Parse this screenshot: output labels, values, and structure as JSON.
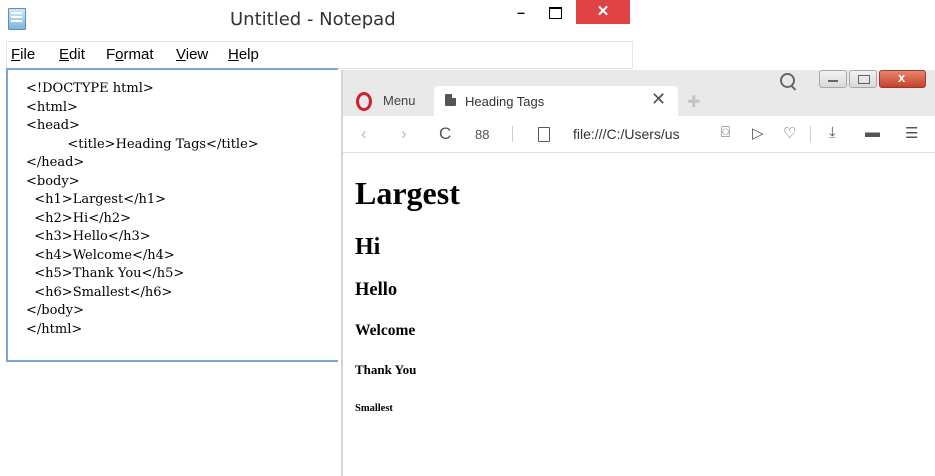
{
  "notepad": {
    "title": "Untitled - Notepad",
    "menu": [
      "File",
      "Edit",
      "Format",
      "View",
      "Help"
    ],
    "menu_mnemonics": [
      "F",
      "E",
      "o",
      "V",
      "H"
    ],
    "code_lines": [
      "<!DOCTYPE html>",
      "<html>",
      "<head>",
      "          <title>Heading Tags</title>",
      "</head>",
      "<body>",
      "  <h1>Largest</h1>",
      "  <h2>Hi</h2>",
      "  <h3>Hello</h3>",
      "  <h4>Welcome</h4>",
      "  <h5>Thank You</h5>",
      "  <h6>Smallest</h6>",
      "</body>",
      "</html>"
    ],
    "window_controls": {
      "minimize": "–",
      "close": "✕"
    }
  },
  "browser": {
    "menu_label": "Menu",
    "tab_title": "Heading Tags",
    "tab_close": "✕",
    "new_tab": "✚",
    "nav": {
      "back": "‹",
      "forward": "›",
      "reload": "C",
      "speed_dial": "88"
    },
    "url": "file:///C:/Users/us",
    "toolbar_icons": [
      "camera-icon",
      "send-icon",
      "heart-icon",
      "download-icon",
      "battery-icon",
      "settings-icon"
    ],
    "toolbar_glyphs": [
      "⌼",
      "▷",
      "♡",
      "⤓",
      "▬",
      "☰"
    ],
    "headings": [
      "Largest",
      "Hi",
      "Hello",
      "Welcome",
      "Thank You",
      "Smallest"
    ]
  },
  "colors": {
    "notepad_close": "#e04343",
    "opera_red": "#d3202a",
    "editor_border": "#7aa7d6"
  }
}
